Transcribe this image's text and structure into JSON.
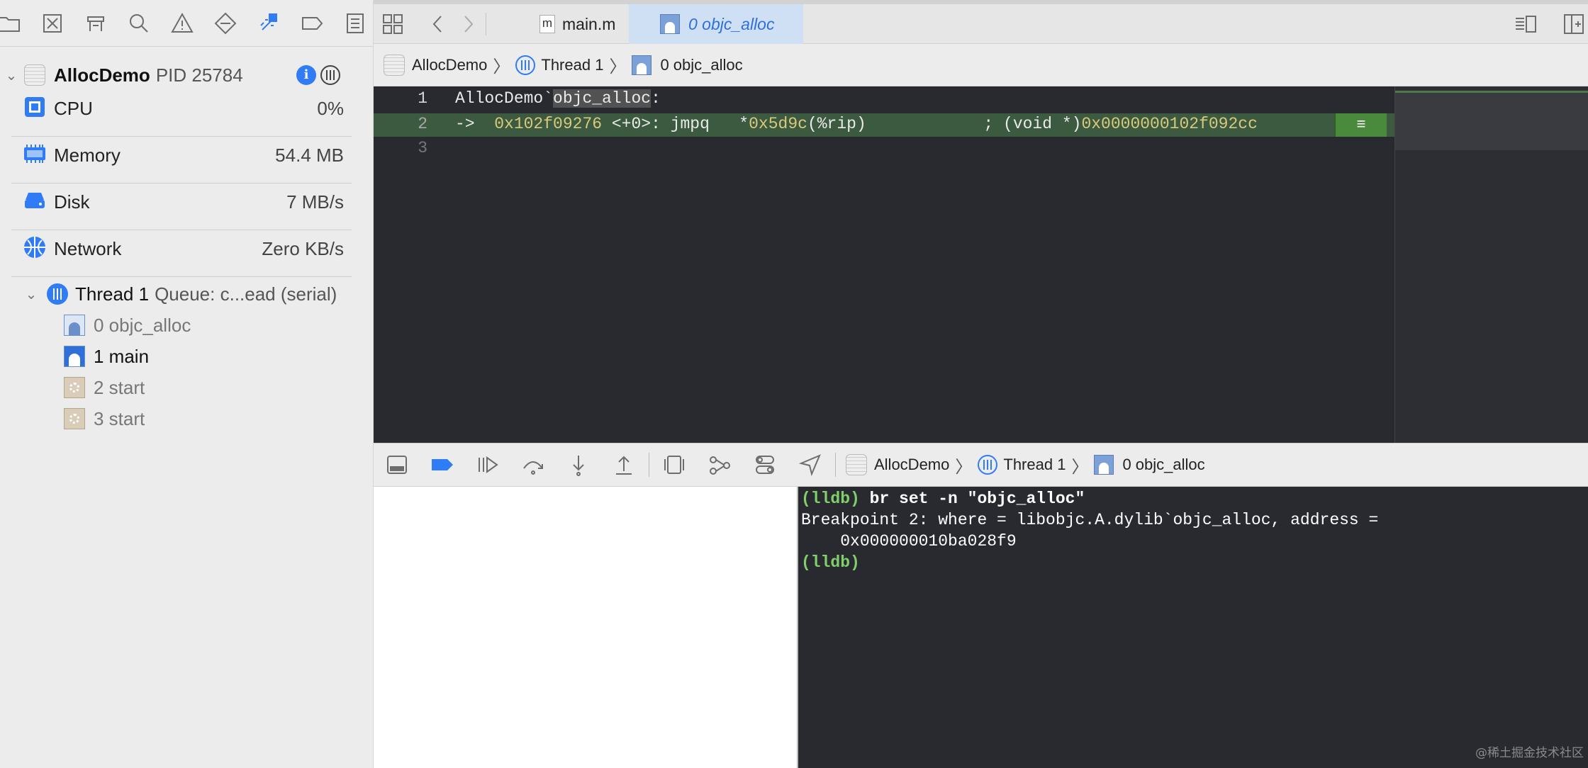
{
  "navigator": {
    "process": {
      "name": "AllocDemo",
      "pid_label": "PID 25784"
    },
    "gauges": [
      {
        "label": "CPU",
        "value": "0%"
      },
      {
        "label": "Memory",
        "value": "54.4 MB"
      },
      {
        "label": "Disk",
        "value": "7 MB/s"
      },
      {
        "label": "Network",
        "value": "Zero KB/s"
      }
    ],
    "thread": {
      "name": "Thread 1",
      "queue": "Queue: c...ead (serial)"
    },
    "frames": [
      {
        "label": "0 objc_alloc"
      },
      {
        "label": "1 main"
      },
      {
        "label": "2 start"
      },
      {
        "label": "3 start"
      }
    ]
  },
  "tabs": [
    {
      "label": "main.m",
      "icon_text": "m"
    },
    {
      "label": "0 objc_alloc"
    }
  ],
  "breadcrumb": [
    "AllocDemo",
    "Thread 1",
    "0 objc_alloc"
  ],
  "code": {
    "lines": [
      {
        "num": "1",
        "prefix": "AllocDemo`",
        "symbol": "objc_alloc",
        "suffix": ":"
      },
      {
        "num": "2",
        "arrow": "->",
        "addr": "0x102f09276",
        "offset": "<+0>",
        "instr": ": jmpq   *",
        "operand": "0x5d9c",
        "operand_suffix": "(%rip)",
        "comment": "; (void *)",
        "comment_addr": "0x0000000102f092cc"
      },
      {
        "num": "3"
      }
    ],
    "breakpoint_glyph": "≡"
  },
  "debug_breadcrumb": [
    "AllocDemo",
    "Thread 1",
    "0 objc_alloc"
  ],
  "console": {
    "prompt": "(lldb)",
    "command": "br set -n \"objc_alloc\"",
    "output_line1": "Breakpoint 2: where = libobjc.A.dylib`objc_alloc, address =",
    "output_line2": "    0x000000010ba028f9",
    "prompt2": "(lldb)",
    "watermark": "@稀土掘金技术社区"
  },
  "colors": {
    "accent": "#2f7cf6",
    "editor_bg": "#292a30",
    "pc_line": "#3b5a3f",
    "lldb_prompt": "#7fcf6a",
    "address_yellow": "#d9c97c"
  }
}
